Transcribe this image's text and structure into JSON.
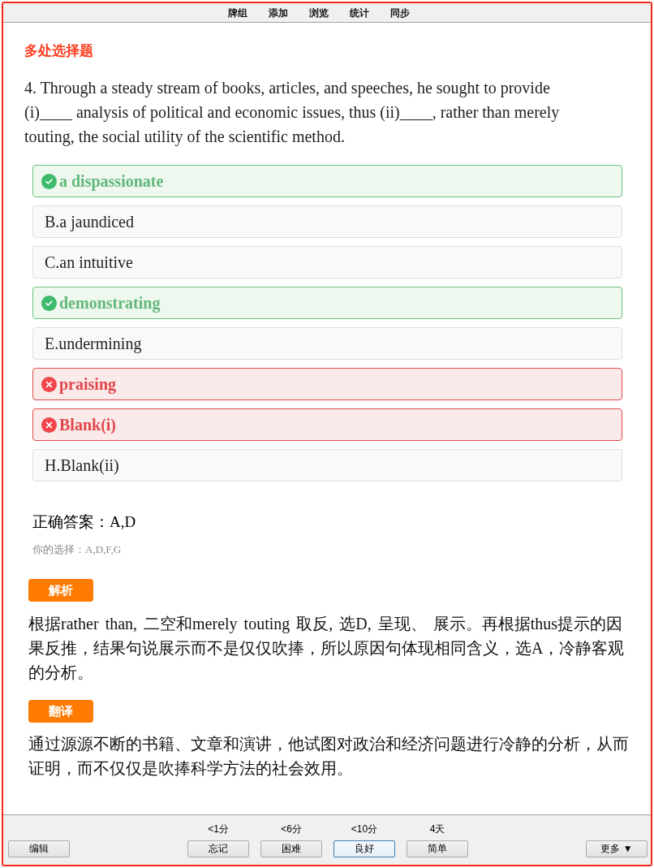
{
  "menu": [
    "牌组",
    "添加",
    "浏览",
    "统计",
    "同步"
  ],
  "question": {
    "type_label": "多处选择题",
    "text": "4. Through a steady stream of books, articles, and speeches, he sought to provide (i)____ analysis of political and economic issues, thus (ii)____, rather than merely touting, the social utility of the scientific method."
  },
  "options": [
    {
      "kind": "correct",
      "text": "a dispassionate"
    },
    {
      "kind": "plain",
      "text": "B.a jaundiced"
    },
    {
      "kind": "plain",
      "text": "C.an intuitive"
    },
    {
      "kind": "correct",
      "text": "demonstrating"
    },
    {
      "kind": "plain",
      "text": "E.undermining"
    },
    {
      "kind": "wrong",
      "text": "praising"
    },
    {
      "kind": "wrong",
      "text": "Blank(i)"
    },
    {
      "kind": "plain",
      "text": "H.Blank(ii)"
    }
  ],
  "result": {
    "correct_answer": "正确答案：A,D",
    "your_choice": "你的选择：A,D,F,G"
  },
  "analysis": {
    "badge": "解析",
    "text": "根据rather than, 二空和merely touting 取反, 选D, 呈现、 展示。再根据thus提示的因果反推，结果句说展示而不是仅仅吹捧，所以原因句体现相同含义，选A，冷静客观的分析。"
  },
  "translation": {
    "badge": "翻译",
    "text": "通过源源不断的书籍、文章和演讲，他试图对政治和经济问题进行冷静的分析，从而证明，而不仅仅是吹捧科学方法的社会效用。"
  },
  "footer": {
    "edit_button": "编辑",
    "answer_buttons": [
      {
        "interval": "<1分",
        "label": "忘记",
        "focused": false
      },
      {
        "interval": "<6分",
        "label": "困难",
        "focused": false
      },
      {
        "interval": "<10分",
        "label": "良好",
        "focused": true
      },
      {
        "interval": "4天",
        "label": "简单",
        "focused": false
      }
    ],
    "more_button": "更多 ▼"
  }
}
